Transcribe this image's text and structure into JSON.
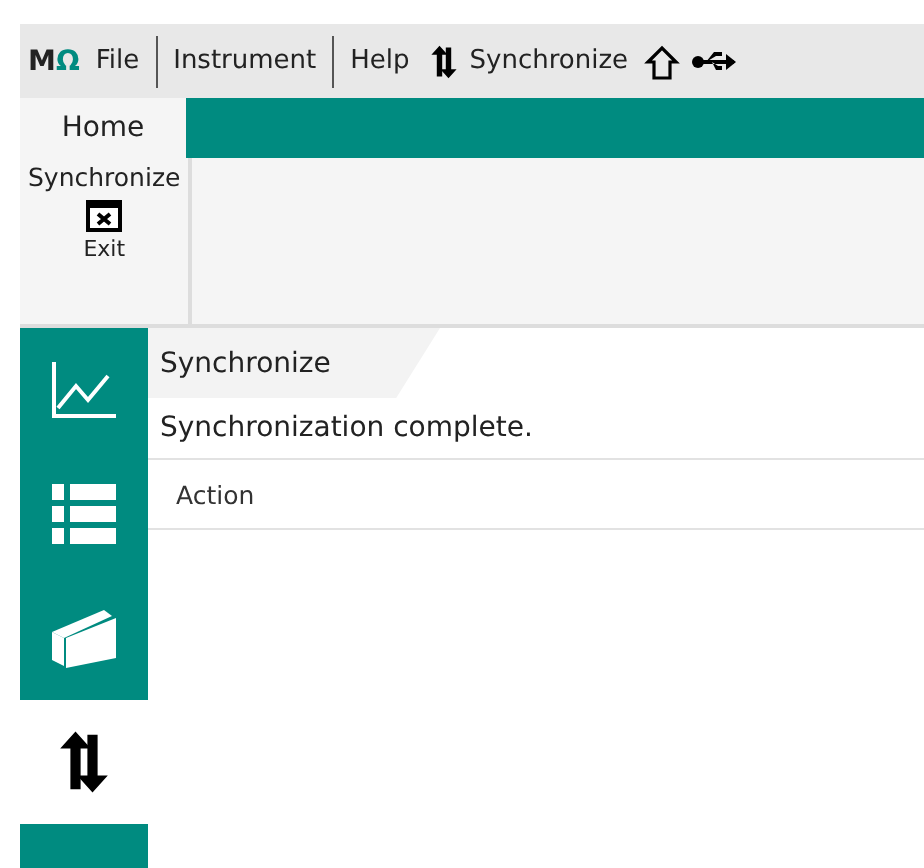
{
  "logo": {
    "letter": "M",
    "mark": "Ω"
  },
  "menu": [
    {
      "label": "File"
    },
    {
      "label": "Instrument"
    },
    {
      "label": "Help"
    }
  ],
  "toolbar": {
    "sync_label": "Synchronize"
  },
  "tabs": [
    {
      "label": "Home",
      "selected": true
    }
  ],
  "ribbon": {
    "group_label": "Synchronize",
    "buttons": [
      {
        "label": "Exit"
      }
    ]
  },
  "sidebar": [
    {
      "kind": "chart",
      "selected": false
    },
    {
      "kind": "list",
      "selected": false
    },
    {
      "kind": "book",
      "selected": false
    },
    {
      "kind": "sync",
      "selected": true
    }
  ],
  "panel": {
    "title": "Synchronize",
    "message": "Synchronization complete.",
    "columns": [
      "Action"
    ]
  }
}
